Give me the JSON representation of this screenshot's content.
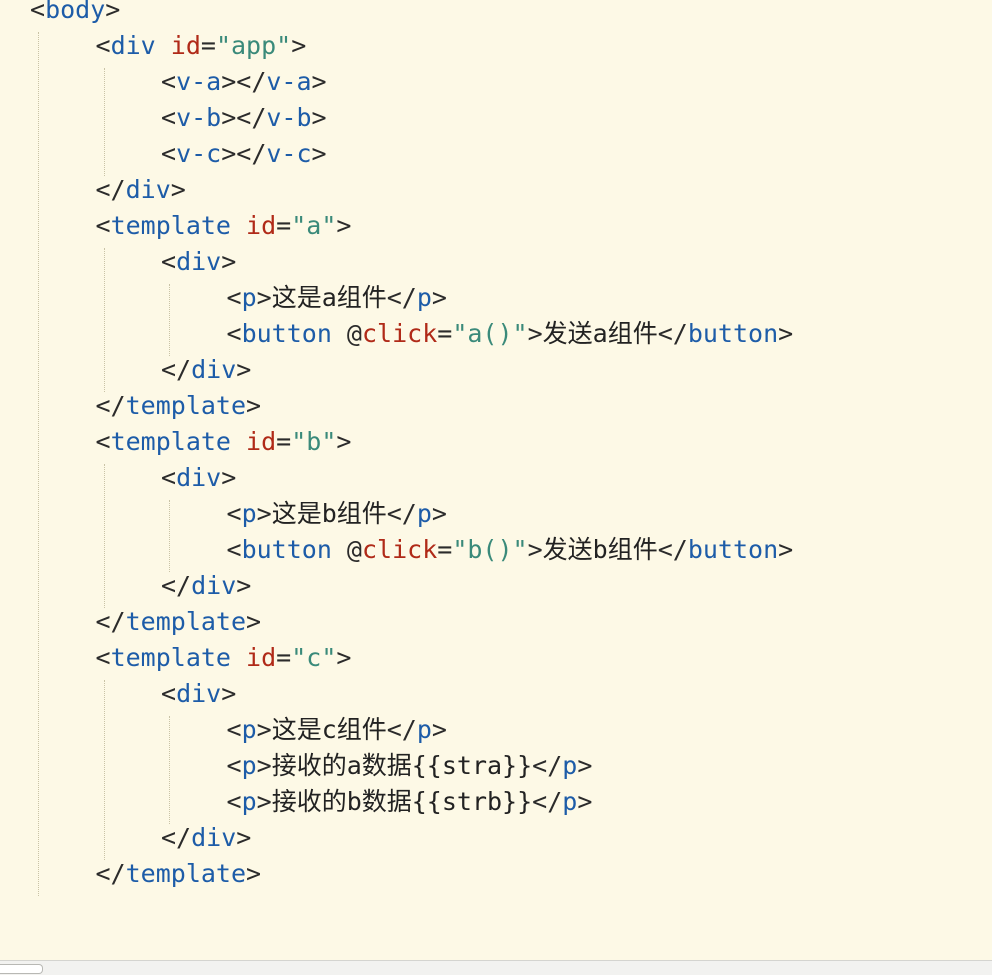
{
  "editor": {
    "colors": {
      "background": "#fdf9e6",
      "tag": "#1d5ca8",
      "attribute": "#b02a18",
      "string": "#3a8a7a",
      "punctuation": "#2b2b2b",
      "text": "#222222",
      "indent_guide": "#c9c3a6"
    },
    "lines": [
      {
        "indent": 0,
        "tokens": [
          {
            "t": "<",
            "k": "punct"
          },
          {
            "t": "body",
            "k": "tag"
          },
          {
            "t": ">",
            "k": "punct"
          }
        ]
      },
      {
        "indent": 1,
        "tokens": [
          {
            "t": "<",
            "k": "punct"
          },
          {
            "t": "div",
            "k": "tag"
          },
          {
            "t": " ",
            "k": "text"
          },
          {
            "t": "id",
            "k": "attr"
          },
          {
            "t": "=",
            "k": "punct"
          },
          {
            "t": "\"app\"",
            "k": "string"
          },
          {
            "t": ">",
            "k": "punct"
          }
        ]
      },
      {
        "indent": 2,
        "tokens": [
          {
            "t": "<",
            "k": "punct"
          },
          {
            "t": "v-a",
            "k": "tag"
          },
          {
            "t": "></",
            "k": "punct"
          },
          {
            "t": "v-a",
            "k": "tag"
          },
          {
            "t": ">",
            "k": "punct"
          }
        ]
      },
      {
        "indent": 2,
        "tokens": [
          {
            "t": "<",
            "k": "punct"
          },
          {
            "t": "v-b",
            "k": "tag"
          },
          {
            "t": "></",
            "k": "punct"
          },
          {
            "t": "v-b",
            "k": "tag"
          },
          {
            "t": ">",
            "k": "punct"
          }
        ]
      },
      {
        "indent": 2,
        "tokens": [
          {
            "t": "<",
            "k": "punct"
          },
          {
            "t": "v-c",
            "k": "tag"
          },
          {
            "t": "></",
            "k": "punct"
          },
          {
            "t": "v-c",
            "k": "tag"
          },
          {
            "t": ">",
            "k": "punct"
          }
        ]
      },
      {
        "indent": 1,
        "tokens": [
          {
            "t": "</",
            "k": "punct"
          },
          {
            "t": "div",
            "k": "tag"
          },
          {
            "t": ">",
            "k": "punct"
          }
        ]
      },
      {
        "indent": 1,
        "tokens": [
          {
            "t": "<",
            "k": "punct"
          },
          {
            "t": "template",
            "k": "tag"
          },
          {
            "t": " ",
            "k": "text"
          },
          {
            "t": "id",
            "k": "attr"
          },
          {
            "t": "=",
            "k": "punct"
          },
          {
            "t": "\"a\"",
            "k": "string"
          },
          {
            "t": ">",
            "k": "punct"
          }
        ]
      },
      {
        "indent": 2,
        "tokens": [
          {
            "t": "<",
            "k": "punct"
          },
          {
            "t": "div",
            "k": "tag"
          },
          {
            "t": ">",
            "k": "punct"
          }
        ]
      },
      {
        "indent": 3,
        "tokens": [
          {
            "t": "<",
            "k": "punct"
          },
          {
            "t": "p",
            "k": "tag"
          },
          {
            "t": ">",
            "k": "punct"
          },
          {
            "t": "这是a组件",
            "k": "text"
          },
          {
            "t": "</",
            "k": "punct"
          },
          {
            "t": "p",
            "k": "tag"
          },
          {
            "t": ">",
            "k": "punct"
          }
        ]
      },
      {
        "indent": 3,
        "tokens": [
          {
            "t": "<",
            "k": "punct"
          },
          {
            "t": "button",
            "k": "tag"
          },
          {
            "t": " @",
            "k": "punct"
          },
          {
            "t": "click",
            "k": "attr"
          },
          {
            "t": "=",
            "k": "punct"
          },
          {
            "t": "\"a()\"",
            "k": "string"
          },
          {
            "t": ">",
            "k": "punct"
          },
          {
            "t": "发送a组件",
            "k": "text"
          },
          {
            "t": "</",
            "k": "punct"
          },
          {
            "t": "button",
            "k": "tag"
          },
          {
            "t": ">",
            "k": "punct"
          }
        ]
      },
      {
        "indent": 2,
        "tokens": [
          {
            "t": "</",
            "k": "punct"
          },
          {
            "t": "div",
            "k": "tag"
          },
          {
            "t": ">",
            "k": "punct"
          }
        ]
      },
      {
        "indent": 1,
        "tokens": [
          {
            "t": "</",
            "k": "punct"
          },
          {
            "t": "template",
            "k": "tag"
          },
          {
            "t": ">",
            "k": "punct"
          }
        ]
      },
      {
        "indent": 1,
        "tokens": [
          {
            "t": "<",
            "k": "punct"
          },
          {
            "t": "template",
            "k": "tag"
          },
          {
            "t": " ",
            "k": "text"
          },
          {
            "t": "id",
            "k": "attr"
          },
          {
            "t": "=",
            "k": "punct"
          },
          {
            "t": "\"b\"",
            "k": "string"
          },
          {
            "t": ">",
            "k": "punct"
          }
        ]
      },
      {
        "indent": 2,
        "tokens": [
          {
            "t": "<",
            "k": "punct"
          },
          {
            "t": "div",
            "k": "tag"
          },
          {
            "t": ">",
            "k": "punct"
          }
        ]
      },
      {
        "indent": 3,
        "tokens": [
          {
            "t": "<",
            "k": "punct"
          },
          {
            "t": "p",
            "k": "tag"
          },
          {
            "t": ">",
            "k": "punct"
          },
          {
            "t": "这是b组件",
            "k": "text"
          },
          {
            "t": "</",
            "k": "punct"
          },
          {
            "t": "p",
            "k": "tag"
          },
          {
            "t": ">",
            "k": "punct"
          }
        ]
      },
      {
        "indent": 3,
        "tokens": [
          {
            "t": "<",
            "k": "punct"
          },
          {
            "t": "button",
            "k": "tag"
          },
          {
            "t": " @",
            "k": "punct"
          },
          {
            "t": "click",
            "k": "attr"
          },
          {
            "t": "=",
            "k": "punct"
          },
          {
            "t": "\"b()\"",
            "k": "string"
          },
          {
            "t": ">",
            "k": "punct"
          },
          {
            "t": "发送b组件",
            "k": "text"
          },
          {
            "t": "</",
            "k": "punct"
          },
          {
            "t": "button",
            "k": "tag"
          },
          {
            "t": ">",
            "k": "punct"
          }
        ]
      },
      {
        "indent": 2,
        "tokens": [
          {
            "t": "</",
            "k": "punct"
          },
          {
            "t": "div",
            "k": "tag"
          },
          {
            "t": ">",
            "k": "punct"
          }
        ]
      },
      {
        "indent": 1,
        "tokens": [
          {
            "t": "</",
            "k": "punct"
          },
          {
            "t": "template",
            "k": "tag"
          },
          {
            "t": ">",
            "k": "punct"
          }
        ]
      },
      {
        "indent": 1,
        "tokens": [
          {
            "t": "<",
            "k": "punct"
          },
          {
            "t": "template",
            "k": "tag"
          },
          {
            "t": " ",
            "k": "text"
          },
          {
            "t": "id",
            "k": "attr"
          },
          {
            "t": "=",
            "k": "punct"
          },
          {
            "t": "\"c\"",
            "k": "string"
          },
          {
            "t": ">",
            "k": "punct"
          }
        ]
      },
      {
        "indent": 2,
        "tokens": [
          {
            "t": "<",
            "k": "punct"
          },
          {
            "t": "div",
            "k": "tag"
          },
          {
            "t": ">",
            "k": "punct"
          }
        ]
      },
      {
        "indent": 3,
        "tokens": [
          {
            "t": "<",
            "k": "punct"
          },
          {
            "t": "p",
            "k": "tag"
          },
          {
            "t": ">",
            "k": "punct"
          },
          {
            "t": "这是c组件",
            "k": "text"
          },
          {
            "t": "</",
            "k": "punct"
          },
          {
            "t": "p",
            "k": "tag"
          },
          {
            "t": ">",
            "k": "punct"
          }
        ]
      },
      {
        "indent": 3,
        "tokens": [
          {
            "t": "<",
            "k": "punct"
          },
          {
            "t": "p",
            "k": "tag"
          },
          {
            "t": ">",
            "k": "punct"
          },
          {
            "t": "接收的a数据{{stra}}",
            "k": "text"
          },
          {
            "t": "</",
            "k": "punct"
          },
          {
            "t": "p",
            "k": "tag"
          },
          {
            "t": ">",
            "k": "punct"
          }
        ]
      },
      {
        "indent": 3,
        "tokens": [
          {
            "t": "<",
            "k": "punct"
          },
          {
            "t": "p",
            "k": "tag"
          },
          {
            "t": ">",
            "k": "punct"
          },
          {
            "t": "接收的b数据{{strb}}",
            "k": "text"
          },
          {
            "t": "</",
            "k": "punct"
          },
          {
            "t": "p",
            "k": "tag"
          },
          {
            "t": ">",
            "k": "punct"
          }
        ]
      },
      {
        "indent": 2,
        "tokens": [
          {
            "t": "</",
            "k": "punct"
          },
          {
            "t": "div",
            "k": "tag"
          },
          {
            "t": ">",
            "k": "punct"
          }
        ]
      },
      {
        "indent": 1,
        "tokens": [
          {
            "t": "</",
            "k": "punct"
          },
          {
            "t": "template",
            "k": "tag"
          },
          {
            "t": ">",
            "k": "punct"
          }
        ]
      }
    ]
  }
}
